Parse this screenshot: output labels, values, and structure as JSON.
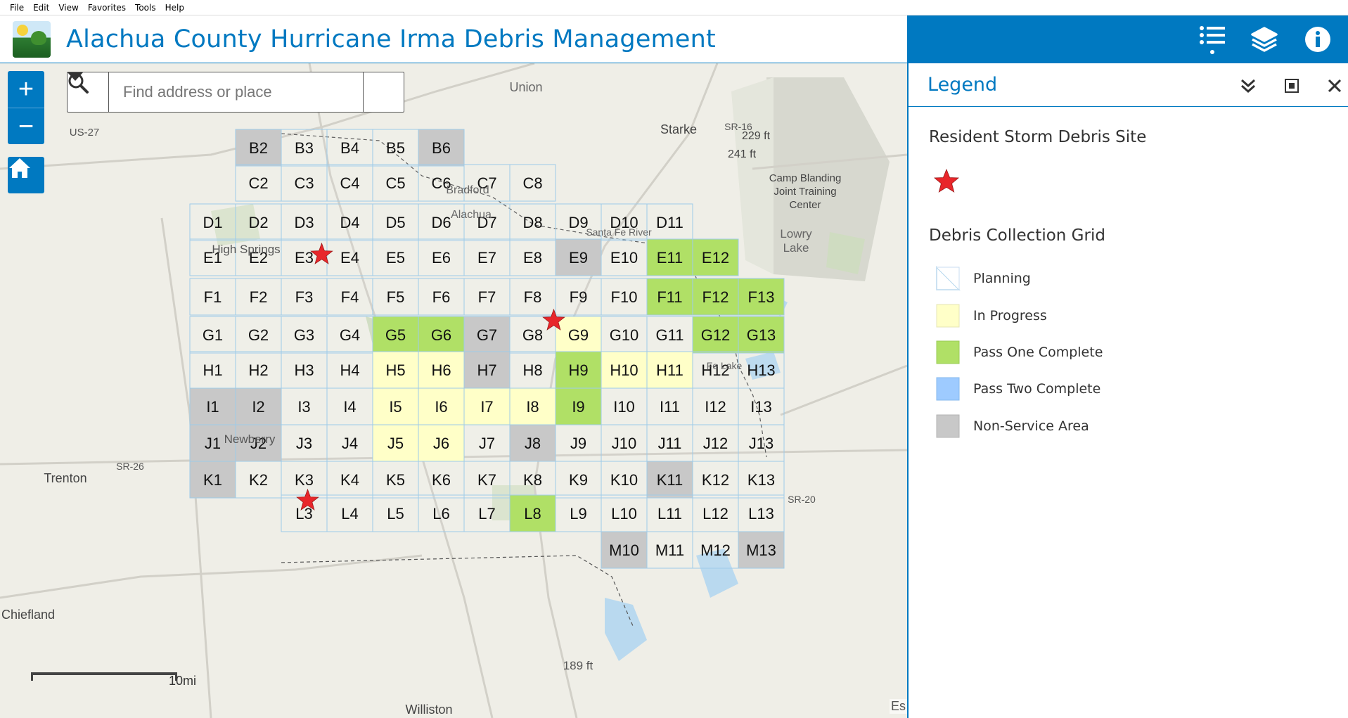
{
  "menu": [
    "File",
    "Edit",
    "View",
    "Favorites",
    "Tools",
    "Help"
  ],
  "app": {
    "title": "Alachua County Hurricane Irma Debris Management"
  },
  "toolbar": {
    "icons": [
      "list-icon",
      "layers-icon",
      "info-icon"
    ]
  },
  "search": {
    "placeholder": "Find address or place"
  },
  "zoom": {
    "in": "+",
    "out": "−"
  },
  "scale": {
    "label": "10mi"
  },
  "attribution": "Es",
  "legend": {
    "title": "Legend",
    "section1": "Resident Storm Debris Site",
    "section2": "Debris Collection Grid",
    "items": [
      {
        "label": "Planning",
        "color": "#ffffff"
      },
      {
        "label": "In Progress",
        "color": "#ffffc8"
      },
      {
        "label": "Pass One Complete",
        "color": "#b0e066"
      },
      {
        "label": "Pass Two Complete",
        "color": "#9ecbff"
      },
      {
        "label": "Non-Service Area",
        "color": "#c8c8c8"
      }
    ]
  },
  "map_labels": [
    {
      "text": "Starke"
    },
    {
      "text": "229 ft"
    },
    {
      "text": "241 ft"
    },
    {
      "text": "Camp Blanding"
    },
    {
      "text": "Joint Training"
    },
    {
      "text": "Center"
    },
    {
      "text": "Lowry"
    },
    {
      "text": "Lake"
    },
    {
      "text": "Trenton"
    },
    {
      "text": "Chiefland"
    },
    {
      "text": "Williston"
    },
    {
      "text": "189 ft"
    },
    {
      "text": "US-27"
    },
    {
      "text": "SR-16"
    },
    {
      "text": "SR-26"
    },
    {
      "text": "SR-20"
    },
    {
      "text": "Union"
    },
    {
      "text": "Bradford"
    },
    {
      "text": "Alachua"
    },
    {
      "text": "Santa Fe River"
    },
    {
      "text": "High Springs"
    },
    {
      "text": "Newberry"
    },
    {
      "text": "Fe Lake"
    }
  ],
  "grid": {
    "rows": [
      {
        "letter": "B",
        "cells": [
          {
            "label": "B2",
            "status": "non"
          },
          {
            "label": "B3",
            "status": "plan"
          },
          {
            "label": "B4",
            "status": "plan"
          },
          {
            "label": "B5",
            "status": "plan"
          },
          {
            "label": "B6",
            "status": "non"
          }
        ]
      },
      {
        "letter": "C",
        "cells": [
          {
            "label": "C2",
            "status": "plan"
          },
          {
            "label": "C3",
            "status": "plan"
          },
          {
            "label": "C4",
            "status": "plan"
          },
          {
            "label": "C5",
            "status": "plan"
          },
          {
            "label": "C6",
            "status": "plan"
          },
          {
            "label": "C7",
            "status": "plan"
          },
          {
            "label": "C8",
            "status": "plan"
          }
        ]
      },
      {
        "letter": "D",
        "cells": [
          {
            "label": "D1",
            "status": "plan"
          },
          {
            "label": "D2",
            "status": "plan"
          },
          {
            "label": "D3",
            "status": "plan"
          },
          {
            "label": "D4",
            "status": "plan"
          },
          {
            "label": "D5",
            "status": "plan"
          },
          {
            "label": "D6",
            "status": "plan"
          },
          {
            "label": "D7",
            "status": "plan"
          },
          {
            "label": "D8",
            "status": "plan"
          },
          {
            "label": "D9",
            "status": "plan"
          },
          {
            "label": "D10",
            "status": "plan"
          },
          {
            "label": "D11",
            "status": "plan"
          }
        ]
      },
      {
        "letter": "E",
        "cells": [
          {
            "label": "E1",
            "status": "plan"
          },
          {
            "label": "E2",
            "status": "plan"
          },
          {
            "label": "E3",
            "status": "plan"
          },
          {
            "label": "E4",
            "status": "plan"
          },
          {
            "label": "E5",
            "status": "plan"
          },
          {
            "label": "E6",
            "status": "plan"
          },
          {
            "label": "E7",
            "status": "plan"
          },
          {
            "label": "E8",
            "status": "plan"
          },
          {
            "label": "E9",
            "status": "non"
          },
          {
            "label": "E10",
            "status": "plan"
          },
          {
            "label": "E11",
            "status": "pass1"
          },
          {
            "label": "E12",
            "status": "pass1"
          }
        ]
      },
      {
        "letter": "F",
        "cells": [
          {
            "label": "F1",
            "status": "plan"
          },
          {
            "label": "F2",
            "status": "plan"
          },
          {
            "label": "F3",
            "status": "plan"
          },
          {
            "label": "F4",
            "status": "plan"
          },
          {
            "label": "F5",
            "status": "plan"
          },
          {
            "label": "F6",
            "status": "plan"
          },
          {
            "label": "F7",
            "status": "plan"
          },
          {
            "label": "F8",
            "status": "plan"
          },
          {
            "label": "F9",
            "status": "plan"
          },
          {
            "label": "F10",
            "status": "plan"
          },
          {
            "label": "F11",
            "status": "pass1"
          },
          {
            "label": "F12",
            "status": "pass1"
          },
          {
            "label": "F13",
            "status": "pass1"
          }
        ]
      },
      {
        "letter": "G",
        "cells": [
          {
            "label": "G1",
            "status": "plan"
          },
          {
            "label": "G2",
            "status": "plan"
          },
          {
            "label": "G3",
            "status": "plan"
          },
          {
            "label": "G4",
            "status": "plan"
          },
          {
            "label": "G5",
            "status": "pass1"
          },
          {
            "label": "G6",
            "status": "pass1"
          },
          {
            "label": "G7",
            "status": "non"
          },
          {
            "label": "G8",
            "status": "plan"
          },
          {
            "label": "G9",
            "status": "prog"
          },
          {
            "label": "G10",
            "status": "plan"
          },
          {
            "label": "G11",
            "status": "plan"
          },
          {
            "label": "G12",
            "status": "pass1"
          },
          {
            "label": "G13",
            "status": "pass1"
          }
        ]
      },
      {
        "letter": "H",
        "cells": [
          {
            "label": "H1",
            "status": "plan"
          },
          {
            "label": "H2",
            "status": "plan"
          },
          {
            "label": "H3",
            "status": "plan"
          },
          {
            "label": "H4",
            "status": "plan"
          },
          {
            "label": "H5",
            "status": "prog"
          },
          {
            "label": "H6",
            "status": "prog"
          },
          {
            "label": "H7",
            "status": "non"
          },
          {
            "label": "H8",
            "status": "plan"
          },
          {
            "label": "H9",
            "status": "pass1"
          },
          {
            "label": "H10",
            "status": "prog"
          },
          {
            "label": "H11",
            "status": "prog"
          },
          {
            "label": "H12",
            "status": "plan"
          },
          {
            "label": "H13",
            "status": "plan"
          }
        ]
      },
      {
        "letter": "I",
        "cells": [
          {
            "label": "I1",
            "status": "non"
          },
          {
            "label": "I2",
            "status": "non"
          },
          {
            "label": "I3",
            "status": "plan"
          },
          {
            "label": "I4",
            "status": "plan"
          },
          {
            "label": "I5",
            "status": "prog"
          },
          {
            "label": "I6",
            "status": "prog"
          },
          {
            "label": "I7",
            "status": "prog"
          },
          {
            "label": "I8",
            "status": "prog"
          },
          {
            "label": "I9",
            "status": "pass1"
          },
          {
            "label": "I10",
            "status": "plan"
          },
          {
            "label": "I11",
            "status": "plan"
          },
          {
            "label": "I12",
            "status": "plan"
          },
          {
            "label": "I13",
            "status": "plan"
          }
        ]
      },
      {
        "letter": "J",
        "cells": [
          {
            "label": "J1",
            "status": "non"
          },
          {
            "label": "J2",
            "status": "non"
          },
          {
            "label": "J3",
            "status": "plan"
          },
          {
            "label": "J4",
            "status": "plan"
          },
          {
            "label": "J5",
            "status": "prog"
          },
          {
            "label": "J6",
            "status": "prog"
          },
          {
            "label": "J7",
            "status": "plan"
          },
          {
            "label": "J8",
            "status": "non"
          },
          {
            "label": "J9",
            "status": "plan"
          },
          {
            "label": "J10",
            "status": "plan"
          },
          {
            "label": "J11",
            "status": "plan"
          },
          {
            "label": "J12",
            "status": "plan"
          },
          {
            "label": "J13",
            "status": "plan"
          }
        ]
      },
      {
        "letter": "K",
        "cells": [
          {
            "label": "K1",
            "status": "non"
          },
          {
            "label": "K2",
            "status": "plan"
          },
          {
            "label": "K3",
            "status": "plan"
          },
          {
            "label": "K4",
            "status": "plan"
          },
          {
            "label": "K5",
            "status": "plan"
          },
          {
            "label": "K6",
            "status": "plan"
          },
          {
            "label": "K7",
            "status": "plan"
          },
          {
            "label": "K8",
            "status": "plan"
          },
          {
            "label": "K9",
            "status": "plan"
          },
          {
            "label": "K10",
            "status": "plan"
          },
          {
            "label": "K11",
            "status": "non"
          },
          {
            "label": "K12",
            "status": "plan"
          },
          {
            "label": "K13",
            "status": "plan"
          }
        ]
      },
      {
        "letter": "L",
        "cells": [
          {
            "label": "L3",
            "status": "plan"
          },
          {
            "label": "L4",
            "status": "plan"
          },
          {
            "label": "L5",
            "status": "plan"
          },
          {
            "label": "L6",
            "status": "plan"
          },
          {
            "label": "L7",
            "status": "plan"
          },
          {
            "label": "L8",
            "status": "pass1"
          },
          {
            "label": "L9",
            "status": "plan"
          },
          {
            "label": "L10",
            "status": "plan"
          },
          {
            "label": "L11",
            "status": "plan"
          },
          {
            "label": "L12",
            "status": "plan"
          },
          {
            "label": "L13",
            "status": "plan"
          }
        ]
      },
      {
        "letter": "M",
        "cells": [
          {
            "label": "M10",
            "status": "non"
          },
          {
            "label": "M11",
            "status": "plan"
          },
          {
            "label": "M12",
            "status": "plan"
          },
          {
            "label": "M13",
            "status": "non"
          }
        ]
      }
    ],
    "debris_sites": [
      "E3",
      "G8",
      "K3"
    ]
  }
}
